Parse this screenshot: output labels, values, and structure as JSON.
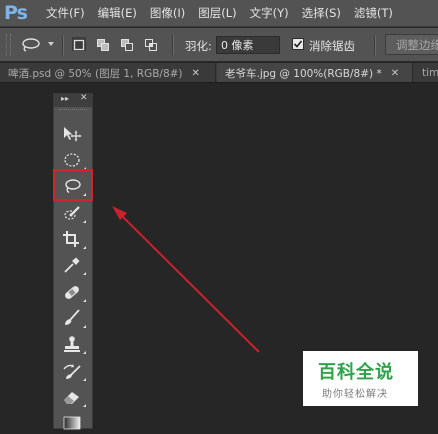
{
  "app": {
    "logo_text": "Ps"
  },
  "menu": {
    "items": [
      "文件(F)",
      "编辑(E)",
      "图像(I)",
      "图层(L)",
      "文字(Y)",
      "选择(S)",
      "滤镜(T)"
    ]
  },
  "options_bar": {
    "feather_label": "羽化:",
    "feather_value": "0 像素",
    "antialias_label": "消除锯齿",
    "antialias_checked": true,
    "refine_edge_label": "调整边缘"
  },
  "tabs": [
    {
      "label": "啤酒.psd @ 50% (图层 1, RGB/8#)",
      "active": false
    },
    {
      "label": "老爷车.jpg @ 100%(RGB/8#) *",
      "active": true
    },
    {
      "label": "tim",
      "active": false
    }
  ],
  "toolbox": {
    "tools": [
      "move-tool",
      "marquee-tool",
      "lasso-tool",
      "quick-selection-tool",
      "crop-tool",
      "eyedropper-tool",
      "spot-healing-tool",
      "brush-tool",
      "clone-stamp-tool",
      "history-brush-tool",
      "eraser-tool",
      "gradient-tool"
    ],
    "highlighted_tool": "lasso-tool",
    "highlight_color": "#d0262b"
  },
  "annotation": {
    "arrow_color": "#c9222a"
  },
  "watermark": {
    "title": "百科全说",
    "subtitle": "助你轻松解决",
    "title_color": "#2ea34a"
  }
}
